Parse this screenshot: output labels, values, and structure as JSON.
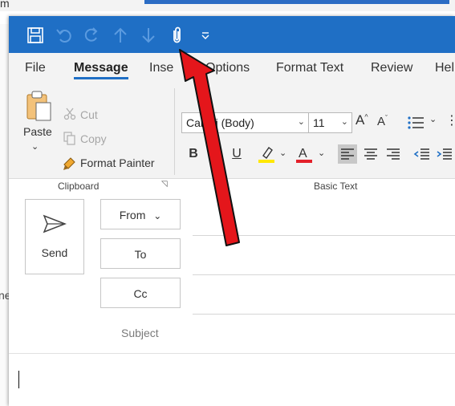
{
  "background": {
    "title_fragment": "m",
    "side_fragment": "ne"
  },
  "quick_access": {
    "icons": [
      "save-icon",
      "undo-icon",
      "redo-icon",
      "up-icon",
      "down-icon",
      "attach-icon",
      "customize-icon"
    ]
  },
  "tabs": {
    "file": "File",
    "message": "Message",
    "insert": "Inse",
    "options": "Options",
    "format_text": "Format Text",
    "review": "Review",
    "help": "Hel"
  },
  "clipboard": {
    "paste": "Paste",
    "cut": "Cut",
    "copy": "Copy",
    "format_painter": "Format Painter",
    "group_label": "Clipboard"
  },
  "basic_text": {
    "font": "Calibri (Body)",
    "size": "11",
    "bold": "B",
    "italic": "I",
    "underline": "U",
    "group_label": "Basic Text"
  },
  "compose": {
    "send": "Send",
    "from": "From",
    "to": "To",
    "cc": "Cc",
    "subject": "Subject"
  },
  "colors": {
    "title_bar": "#1f6fc5",
    "highlight": "#ffe800",
    "font_color": "#e3202a",
    "annotation_arrow": "#e4161b"
  }
}
